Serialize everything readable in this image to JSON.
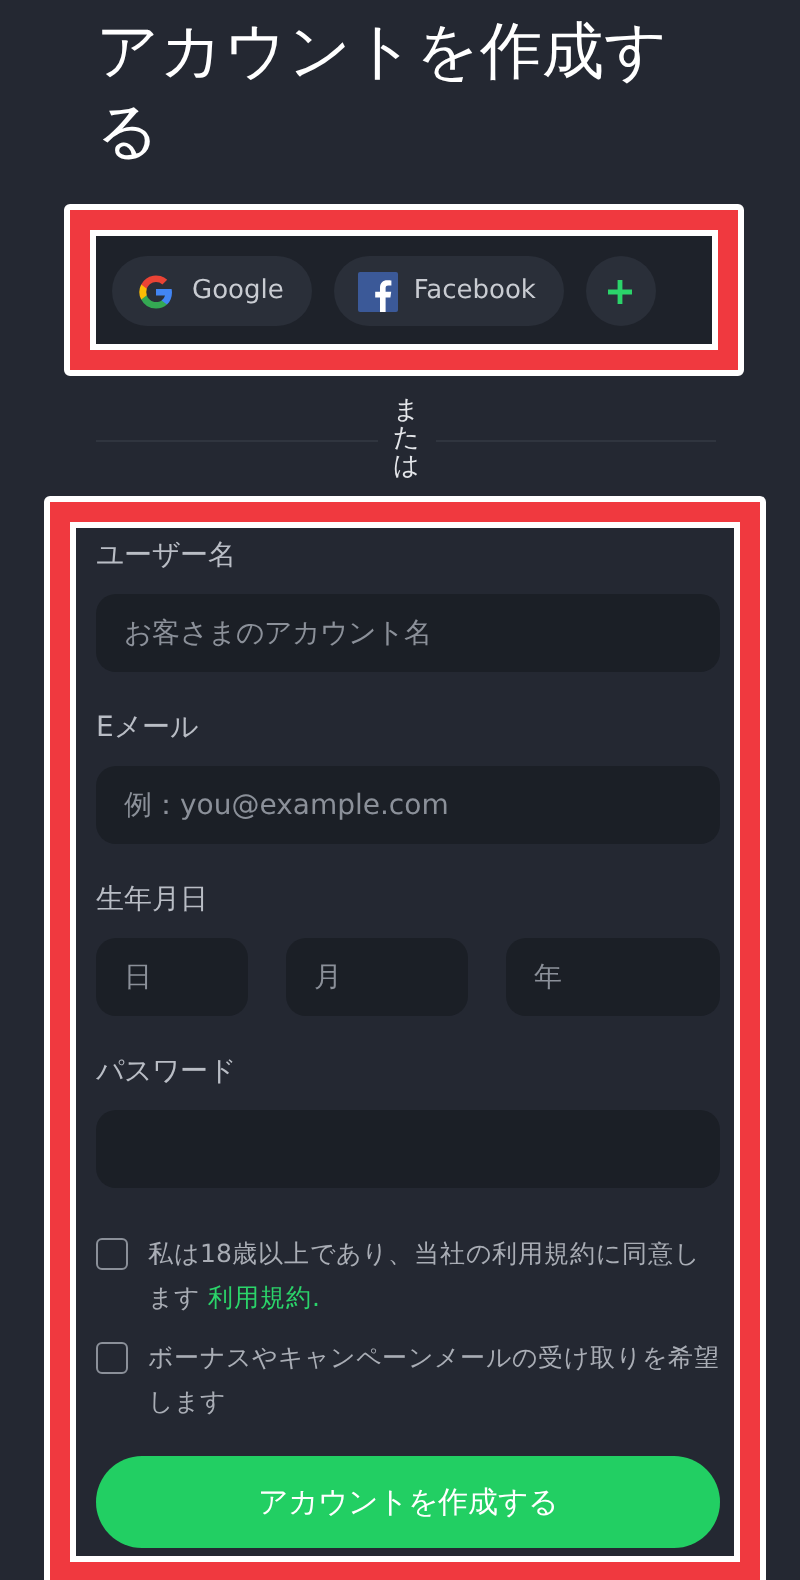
{
  "title": "アカウントを作成する",
  "social_buttons": [
    {
      "kind": "google",
      "label": "Google"
    },
    {
      "kind": "facebook",
      "label": "Facebook"
    },
    {
      "kind": "more"
    }
  ],
  "divider_text": "または",
  "fields": [
    {
      "kind": "text",
      "label": "ユーザー名",
      "placeholder": "お客さまのアカウント名"
    },
    {
      "kind": "text",
      "label": "Eメール",
      "placeholder": "例：you@example.com"
    },
    {
      "kind": "date",
      "label": "生年月日",
      "parts": [
        {
          "placeholder": "日"
        },
        {
          "placeholder": "月"
        },
        {
          "placeholder": "年"
        }
      ]
    },
    {
      "kind": "password",
      "label": "パスワード"
    }
  ],
  "checkboxes": [
    {
      "text": "私は18歳以上であり、当社の利用規約に同意します",
      "link": "利用規約.",
      "checked": false
    },
    {
      "text": "ボーナスやキャンペーンメールの受け取りを希望します",
      "checked": false
    }
  ],
  "submit": "アカウントを作成する"
}
